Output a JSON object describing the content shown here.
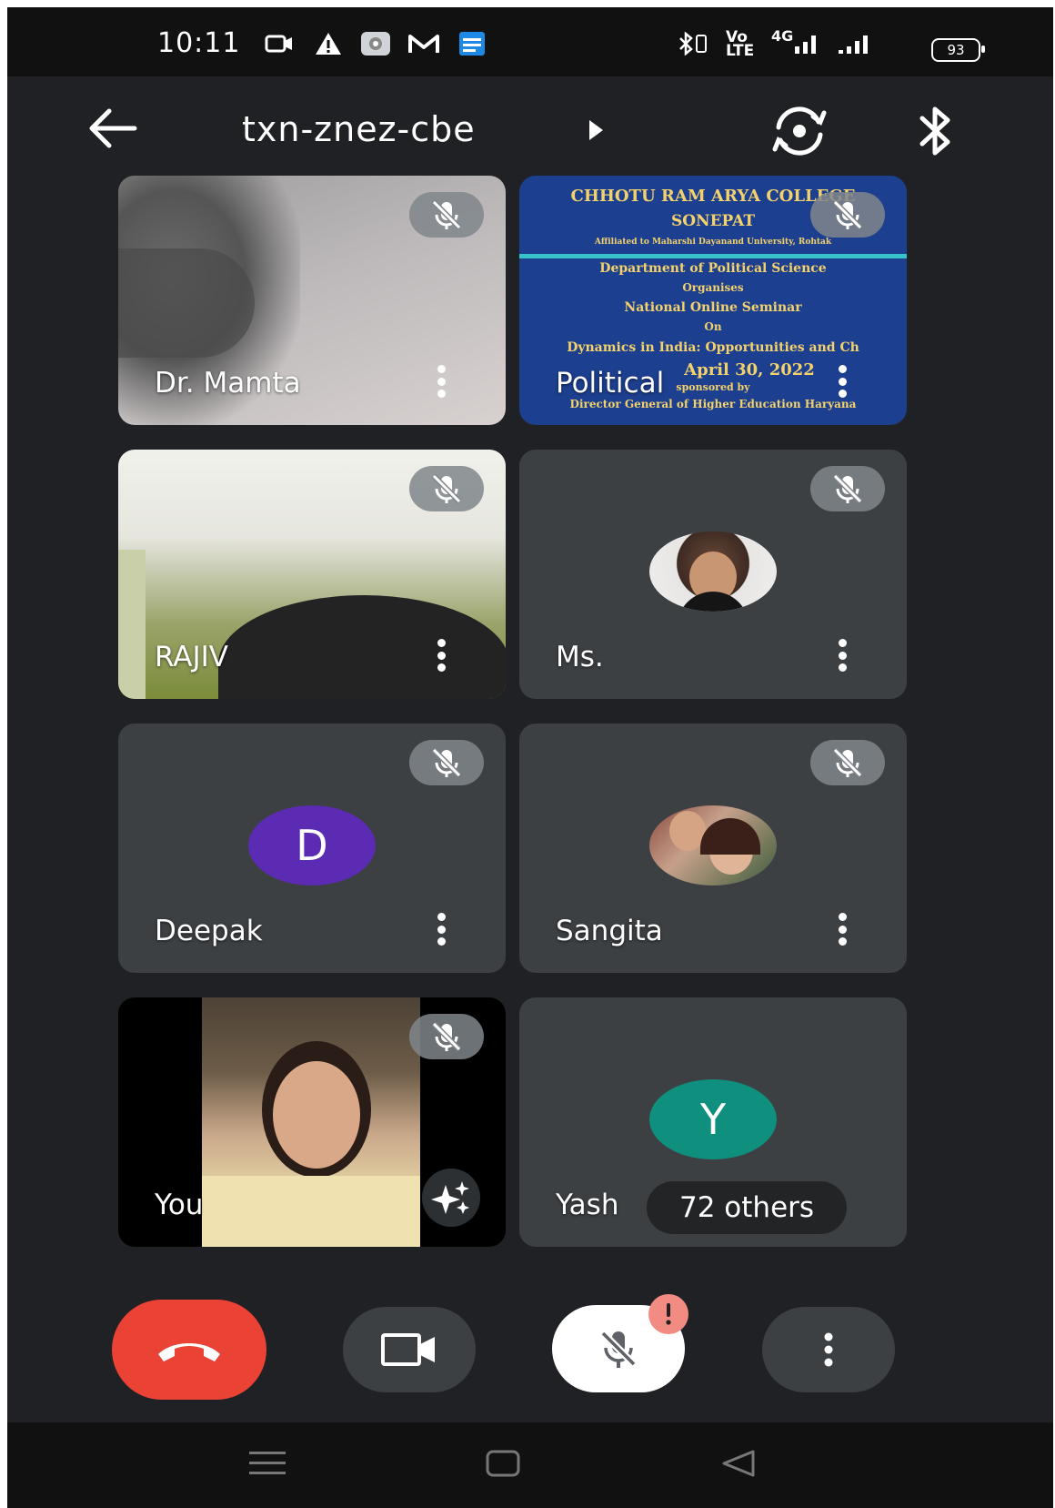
{
  "status_bar": {
    "time": "10:11",
    "network_labels": [
      "Vo",
      "LTE",
      "4G"
    ],
    "battery": "93"
  },
  "meeting": {
    "code": "txn-znez-cbe"
  },
  "participants": [
    {
      "name": "Dr. Mamta"
    },
    {
      "name": "Political"
    },
    {
      "name": "RAJIV"
    },
    {
      "name": "Ms."
    },
    {
      "name": "Deepak",
      "initial": "D",
      "color": "#5b2bb3"
    },
    {
      "name": "Sangita"
    },
    {
      "name": "You"
    },
    {
      "name": "Yash",
      "initial": "Y",
      "color": "#0f8f7e"
    }
  ],
  "others": "72 others",
  "slide": {
    "lines": [
      "CHHOTU RAM ARYA COLLEGE",
      "SONEPAT",
      "Affiliated to Maharshi Dayanand University, Rohtak",
      "Department of Political Science",
      "Organises",
      "National Online Seminar",
      "On",
      "Dynamics in India: Opportunities and Ch",
      "April 30, 2022",
      "sponsored by",
      "Director General of Higher Education Haryana"
    ]
  },
  "colors": {
    "background": "#202124",
    "tile": "#3c4043",
    "end_call": "#ea4335",
    "mic_alert": "#f28b82"
  }
}
